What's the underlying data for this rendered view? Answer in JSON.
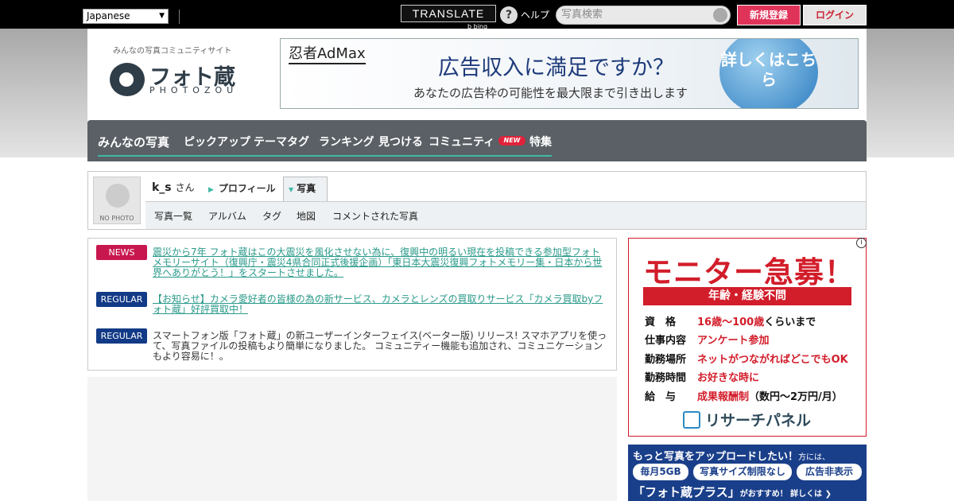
{
  "topbar": {
    "language": "Japanese",
    "translate": "TRANSLATE",
    "bing": "b bing",
    "help": "ヘルプ",
    "search_placeholder": "写真検索",
    "register": "新規登録",
    "login": "ログイン"
  },
  "header": {
    "tagline": "みんなの写真コミュニティサイト",
    "logo_jp": "フォト蔵",
    "logo_en": "PHOTOZOU",
    "ad": {
      "brand": "忍者AdMax",
      "headline": "広告収入に満足ですか？",
      "subline": "あなたの広告枠の可能性を最大限まで引き出します",
      "cta": "詳しくはこちら"
    }
  },
  "nav": {
    "items": [
      "みんなの写真",
      "ピックアップ",
      "テーマタグ",
      "ランキング",
      "見つける",
      "コミュニティ",
      "特集"
    ],
    "new_badge": "NEW"
  },
  "profile": {
    "no_photo": "NO PHOTO",
    "username": "k_s",
    "honorific": "さん",
    "tab_profile": "プロフィール",
    "tab_photos": "写真",
    "subnav": [
      "写真一覧",
      "アルバム",
      "タグ",
      "地図",
      "コメントされた写真"
    ]
  },
  "news": [
    {
      "badge": "NEWS",
      "text": "震災から7年 フォト蔵はこの大震災を風化させない為に、復興中の明るい現在を投稿できる参加型フォトメモリーサイト（復興庁・震災4県合同正式後援企画）「東日本大震災復興フォトメモリー集・日本から世界へありがとう！」をスタートさせました。"
    },
    {
      "badge": "REGULAR",
      "text": "【お知らせ】カメラ愛好者の皆様の為の新サービス、カメラとレンズの買取りサービス「カメラ買取byフォト蔵」好評買取中！"
    },
    {
      "badge": "REGULAR",
      "text": "スマートフォン版「フォト蔵」の新ユーザーインターフェイス(ベーター版) リリース! スマホアプリを使って、写真ファイルの投稿もより簡単になりました。 コミュニティー機能も追加され、コミュニケーションもより容易に！。"
    }
  ],
  "monitor_ad": {
    "title": "モニター急募！",
    "bar": "年齢・経験不問",
    "rows": [
      {
        "label": "資　格",
        "value": "16歳〜100歳",
        "suffix": "くらいまで"
      },
      {
        "label": "仕事内容",
        "value": "アンケート参加",
        "suffix": ""
      },
      {
        "label": "勤務場所",
        "value": "ネットがつながればどこでもOK",
        "suffix": ""
      },
      {
        "label": "勤務時間",
        "value": "お好きな時に",
        "suffix": ""
      },
      {
        "label": "給　与",
        "value": "成果報酬制",
        "suffix": "（数円〜2万円/月）"
      }
    ],
    "brand": "リサーチパネル",
    "info": "i"
  },
  "plus_ad": {
    "line1": "もっと写真をアップロードしたい！",
    "line1_small": "方には、",
    "pills": [
      "毎月5GB",
      "写真サイズ制限なし",
      "広告非表示"
    ],
    "line3": "「フォト蔵プラス」",
    "line3_small": "がおすすめ！ 詳しくは ❯"
  }
}
